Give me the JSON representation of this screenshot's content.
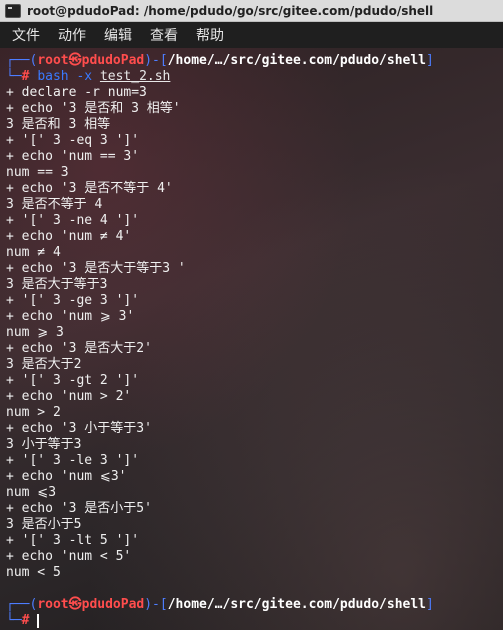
{
  "window": {
    "title": "root@pdudoPad: /home/pdudo/go/src/gitee.com/pdudo/shell"
  },
  "menu": [
    "文件",
    "动作",
    "编辑",
    "查看",
    "帮助"
  ],
  "prompt": {
    "user_host": "root㉿pdudoPad",
    "path": "/home/…/src/gitee.com/pdudo/shell",
    "symbol": "#"
  },
  "command": {
    "bin": "bash",
    "flag": "-x",
    "file": "test_2.sh"
  },
  "output": [
    "+ declare -r num=3",
    "+ echo '3 是否和 3 相等'",
    "3 是否和 3 相等",
    "+ '[' 3 -eq 3 ']'",
    "+ echo 'num == 3'",
    "num == 3",
    "+ echo '3 是否不等于 4'",
    "3 是否不等于 4",
    "+ '[' 3 -ne 4 ']'",
    "+ echo 'num ≠ 4'",
    "num ≠ 4",
    "+ echo '3 是否大于等于3 '",
    "3 是否大于等于3",
    "+ '[' 3 -ge 3 ']'",
    "+ echo 'num ⩾ 3'",
    "num ⩾ 3",
    "+ echo '3 是否大于2'",
    "3 是否大于2",
    "+ '[' 3 -gt 2 ']'",
    "+ echo 'num > 2'",
    "num > 2",
    "+ echo '3 小于等于3'",
    "3 小于等于3",
    "+ '[' 3 -le 3 ']'",
    "+ echo 'num ⩽3'",
    "num ⩽3",
    "+ echo '3 是否小于5'",
    "3 是否小于5",
    "+ '[' 3 -lt 5 ']'",
    "+ echo 'num < 5'",
    "num < 5"
  ]
}
